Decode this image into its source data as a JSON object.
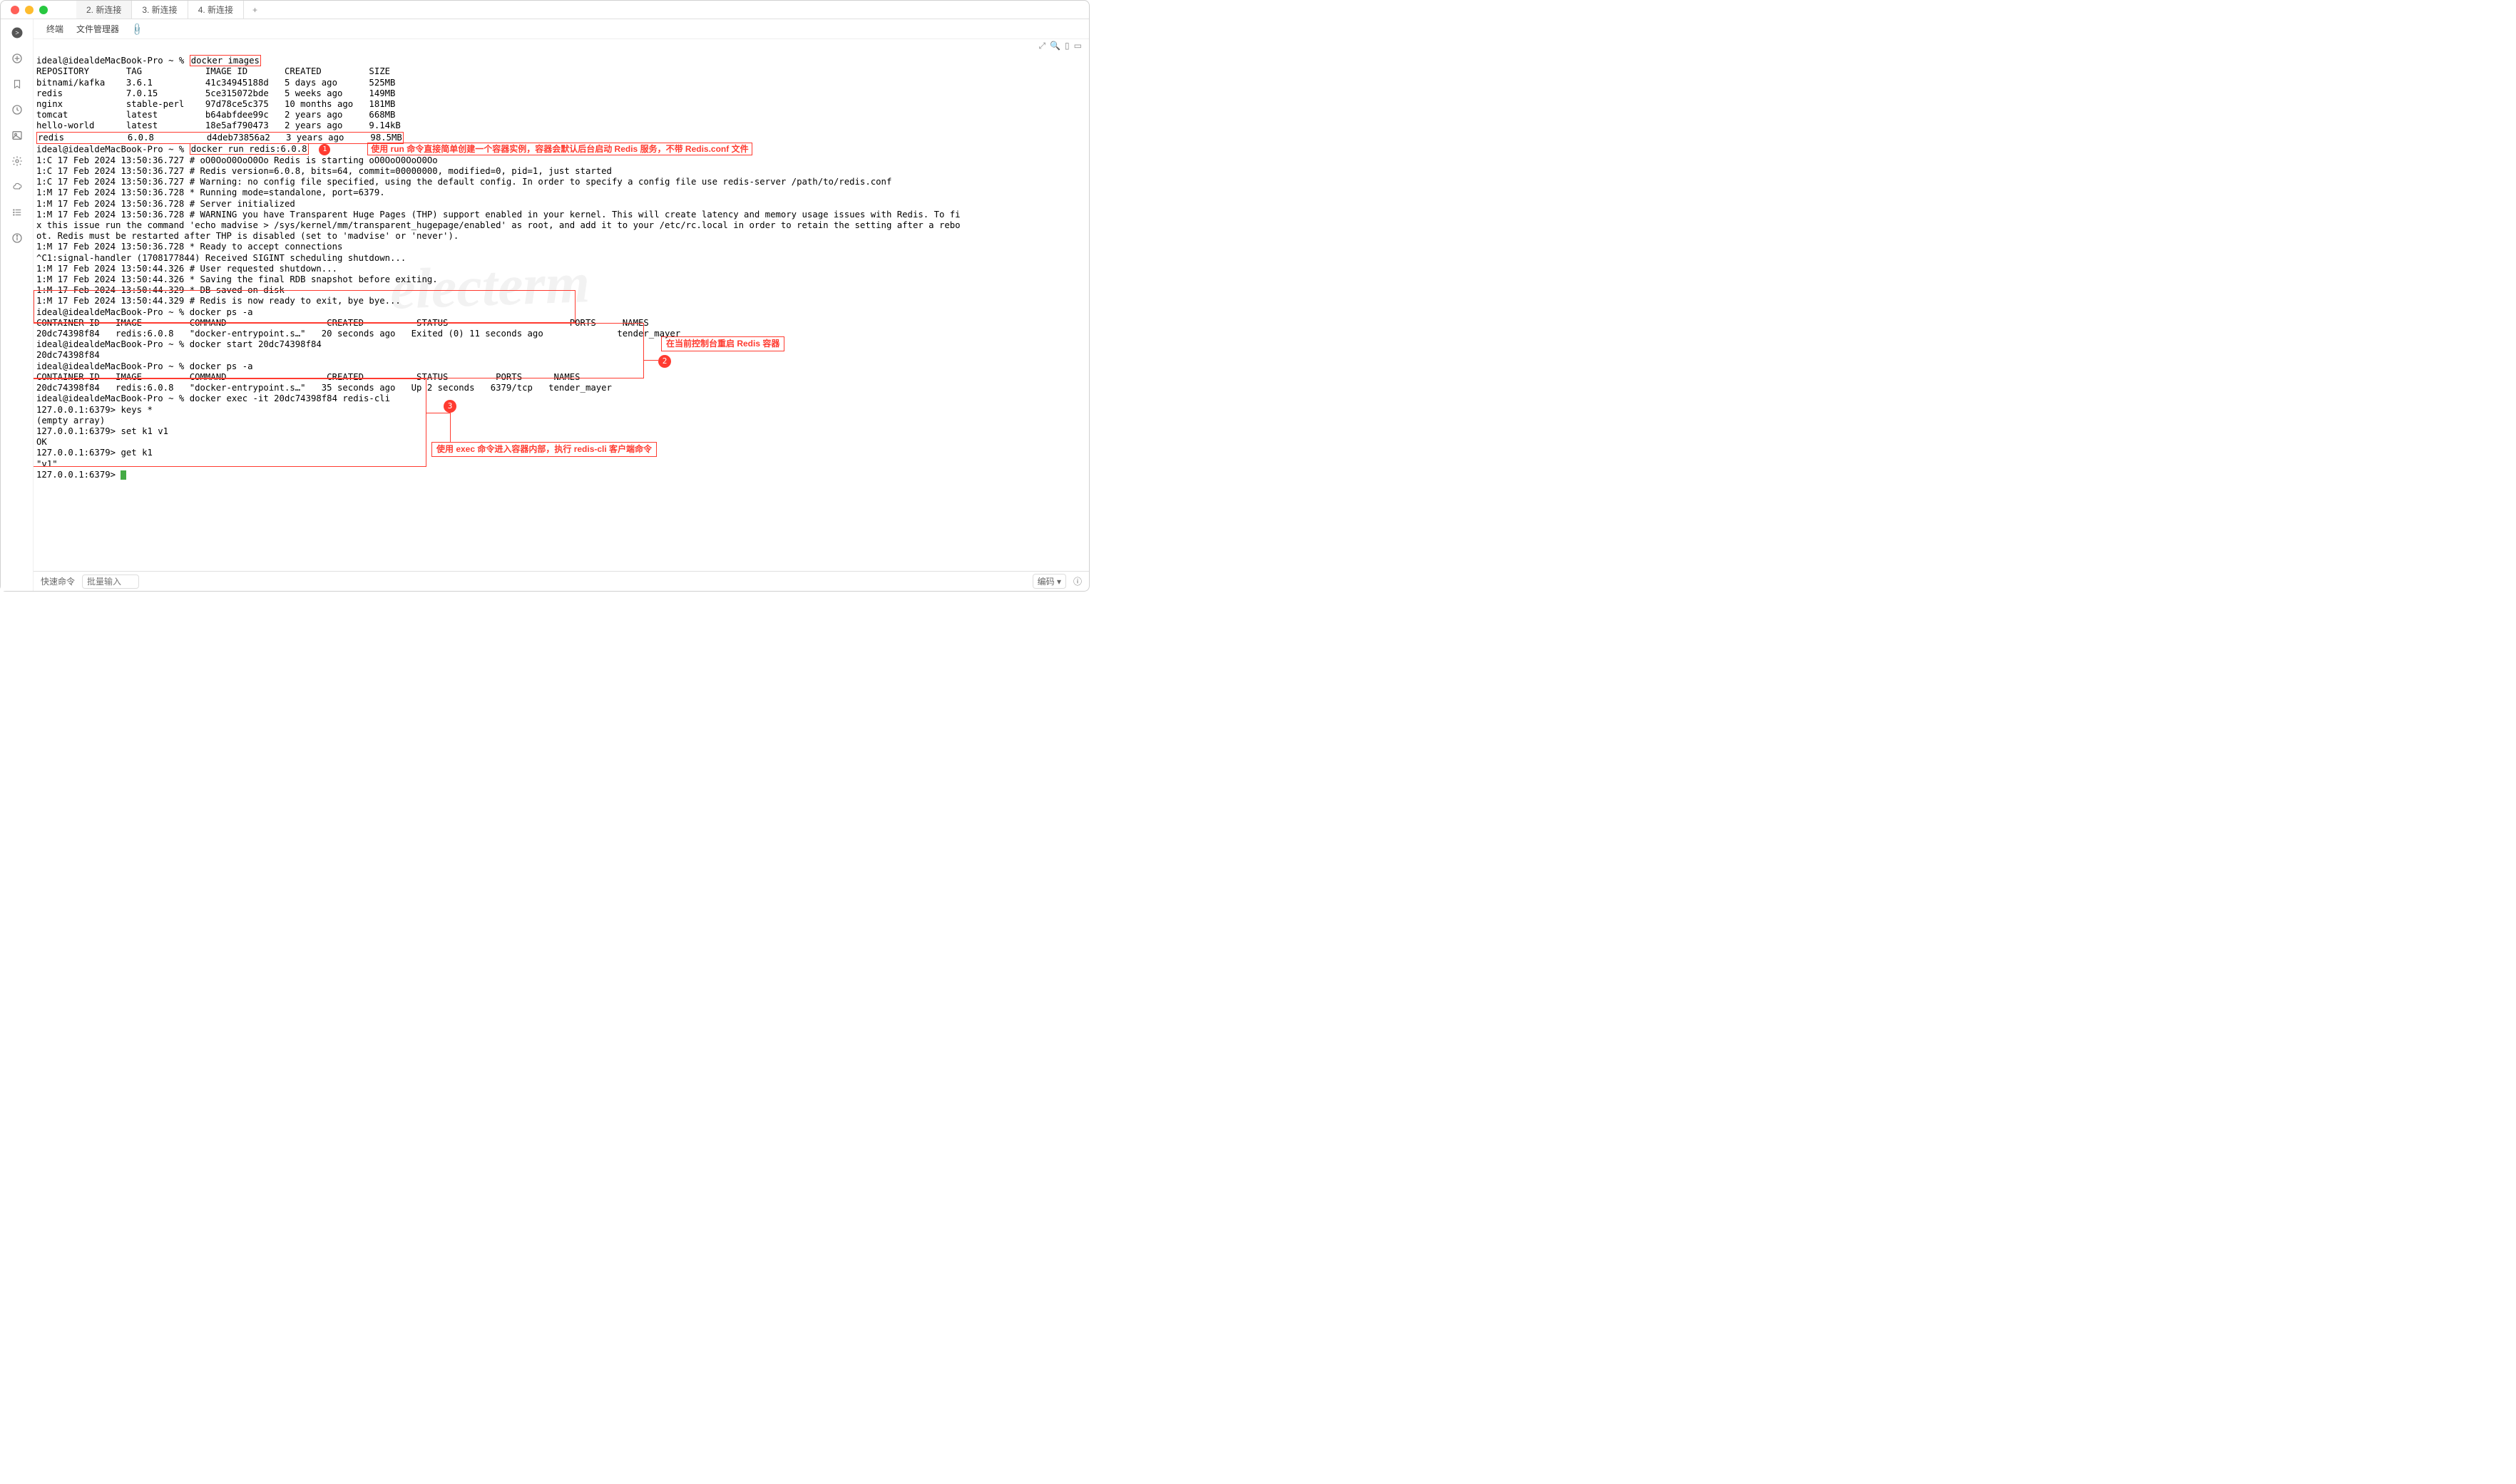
{
  "window": {
    "tabs": [
      {
        "label": "2. 新连接"
      },
      {
        "label": "3. 新连接"
      },
      {
        "label": "4. 新连接"
      }
    ],
    "subtabs": {
      "terminal": "终端",
      "filemgr": "文件管理器"
    }
  },
  "prompt": "ideal@idealdeMacBook-Pro ~ % ",
  "cmd1": "docker images",
  "images_header": "REPOSITORY       TAG            IMAGE ID       CREATED         SIZE",
  "images": [
    "bitnami/kafka    3.6.1          41c34945188d   5 days ago      525MB",
    "redis            7.0.15         5ce315072bde   5 weeks ago     149MB",
    "nginx            stable-perl    97d78ce5c375   10 months ago   181MB",
    "tomcat           latest         b64abfdee99c   2 years ago     668MB",
    "hello-world      latest         18e5af790473   2 years ago     9.14kB"
  ],
  "redis_row": "redis            6.0.8          d4deb73856a2   3 years ago     98.5MB",
  "cmd2": "docker run redis:6.0.8",
  "ann1": "使用 run 命令直接简单创建一个容器实例，容器会默认后台启动 Redis 服务，不带 Redis.conf 文件",
  "run_output": [
    "1:C 17 Feb 2024 13:50:36.727 # oO0OoO0OoO0Oo Redis is starting oO0OoO0OoO0Oo",
    "1:C 17 Feb 2024 13:50:36.727 # Redis version=6.0.8, bits=64, commit=00000000, modified=0, pid=1, just started",
    "1:C 17 Feb 2024 13:50:36.727 # Warning: no config file specified, using the default config. In order to specify a config file use redis-server /path/to/redis.conf",
    "1:M 17 Feb 2024 13:50:36.728 * Running mode=standalone, port=6379.",
    "1:M 17 Feb 2024 13:50:36.728 # Server initialized",
    "1:M 17 Feb 2024 13:50:36.728 # WARNING you have Transparent Huge Pages (THP) support enabled in your kernel. This will create latency and memory usage issues with Redis. To fi",
    "x this issue run the command 'echo madvise > /sys/kernel/mm/transparent_hugepage/enabled' as root, and add it to your /etc/rc.local in order to retain the setting after a rebo",
    "ot. Redis must be restarted after THP is disabled (set to 'madvise' or 'never').",
    "1:M 17 Feb 2024 13:50:36.728 * Ready to accept connections",
    "^C1:signal-handler (1708177844) Received SIGINT scheduling shutdown...",
    "1:M 17 Feb 2024 13:50:44.326 # User requested shutdown...",
    "1:M 17 Feb 2024 13:50:44.326 * Saving the final RDB snapshot before exiting.",
    "1:M 17 Feb 2024 13:50:44.329 * DB saved on disk",
    "1:M 17 Feb 2024 13:50:44.329 # Redis is now ready to exit, bye bye..."
  ],
  "ps_a_1": [
    "ideal@idealdeMacBook-Pro ~ % docker ps -a",
    "CONTAINER ID   IMAGE         COMMAND                   CREATED          STATUS                       PORTS     NAMES",
    "20dc74398f84   redis:6.0.8   \"docker-entrypoint.s…\"   20 seconds ago   Exited (0) 11 seconds ago              tender_mayer"
  ],
  "block2": [
    "ideal@idealdeMacBook-Pro ~ % docker start 20dc74398f84",
    "20dc74398f84",
    "ideal@idealdeMacBook-Pro ~ % docker ps -a",
    "CONTAINER ID   IMAGE         COMMAND                   CREATED          STATUS         PORTS      NAMES",
    "20dc74398f84   redis:6.0.8   \"docker-entrypoint.s…\"   35 seconds ago   Up 2 seconds   6379/tcp   tender_mayer"
  ],
  "ann2": "在当前控制台重启 Redis 容器",
  "block3": [
    "ideal@idealdeMacBook-Pro ~ % docker exec -it 20dc74398f84 redis-cli",
    "127.0.0.1:6379> keys *",
    "(empty array)",
    "127.0.0.1:6379> set k1 v1",
    "OK",
    "127.0.0.1:6379> get k1",
    "\"v1\"",
    "127.0.0.1:6379> "
  ],
  "ann3": "使用 exec 命令进入容器内部，执行 redis-cli 客户端命令",
  "footer": {
    "quick": "快速命令",
    "batch_placeholder": "批量输入",
    "encoding": "编码"
  },
  "watermark": "electerm"
}
